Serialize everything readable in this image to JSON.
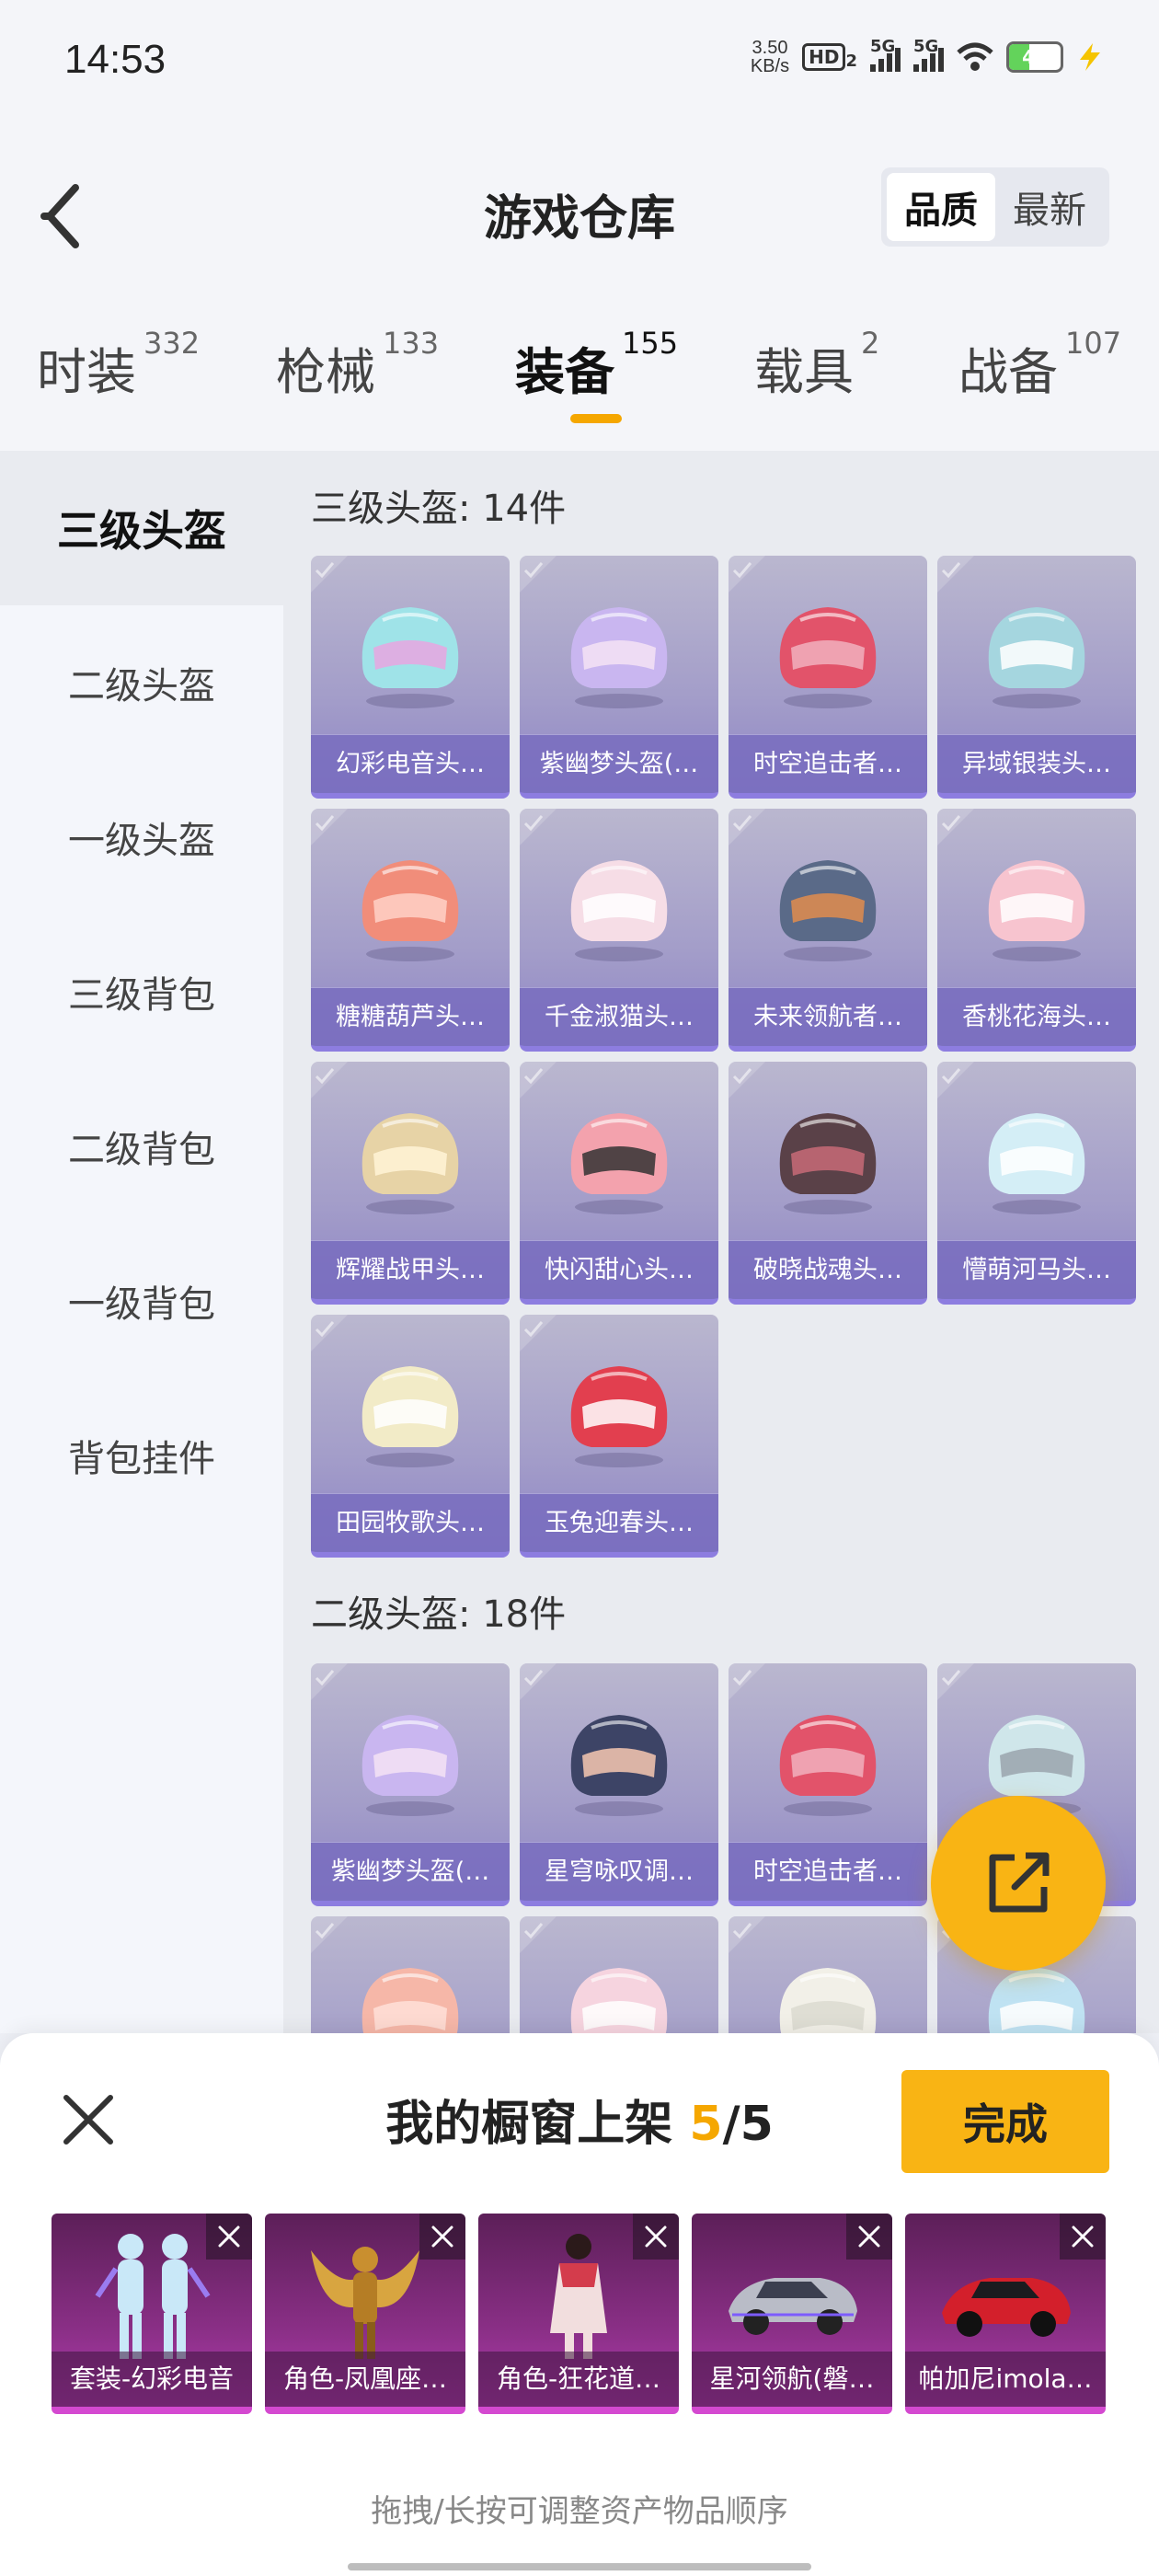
{
  "status_bar": {
    "time": "14:53",
    "net_speed_value": "3.50",
    "net_speed_unit": "KB/s",
    "hd": "HD",
    "hd_sub": "2",
    "signal1": "5G",
    "signal2": "5G",
    "battery": "40"
  },
  "header": {
    "title": "游戏仓库",
    "sort_options": [
      "品质",
      "最新"
    ],
    "sort_selected": "品质"
  },
  "tabs": [
    {
      "label": "时装",
      "count": "332"
    },
    {
      "label": "枪械",
      "count": "133"
    },
    {
      "label": "装备",
      "count": "155",
      "active": true
    },
    {
      "label": "载具",
      "count": "2"
    },
    {
      "label": "战备",
      "count": "107"
    }
  ],
  "sidebar": [
    "三级头盔",
    "二级头盔",
    "一级头盔",
    "三级背包",
    "二级背包",
    "一级背包",
    "背包挂件"
  ],
  "sections": [
    {
      "title": "三级头盔: 14件",
      "items": [
        "幻彩电音头…",
        "紫幽梦头盔(…",
        "时空追击者…",
        "异域银装头…",
        "糖糖葫芦头…",
        "千金淑猫头…",
        "未来领航者…",
        "香桃花海头…",
        "辉耀战甲头…",
        "快闪甜心头…",
        "破晓战魂头…",
        "懵萌河马头…",
        "田园牧歌头…",
        "玉兔迎春头…"
      ]
    },
    {
      "title": "二级头盔: 18件",
      "items": [
        "紫幽梦头盔(…",
        "星穹咏叹调…",
        "时空追击者…",
        "",
        "",
        "",
        "",
        ""
      ]
    }
  ],
  "showcase": {
    "title_prefix": "我的橱窗上架",
    "count": "5",
    "separator": "/",
    "total": "5",
    "done_label": "完成",
    "items": [
      "套装-幻彩电音",
      "角色-凤凰座…",
      "角色-狂花道…",
      "星河领航(磐…",
      "帕加尼imola…"
    ],
    "hint": "拖拽/长按可调整资产物品顺序"
  },
  "colors": {
    "accent": "#f9b414",
    "card_purple": "#a39dc9",
    "showcase_magenta": "#8a2f86"
  }
}
